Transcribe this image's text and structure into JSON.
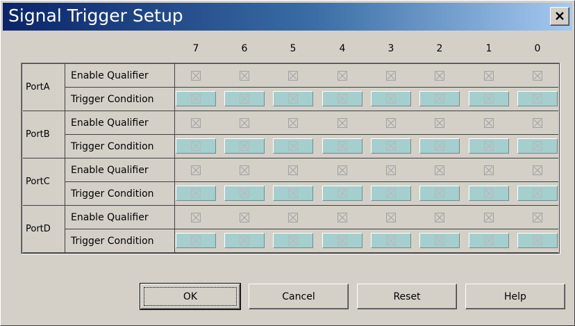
{
  "window": {
    "title": "Signal Trigger Setup"
  },
  "columns": [
    "7",
    "6",
    "5",
    "4",
    "3",
    "2",
    "1",
    "0"
  ],
  "ports": [
    {
      "name": "PortA",
      "enable_label": "Enable Qualifier",
      "trigger_label": "Trigger Condition"
    },
    {
      "name": "PortB",
      "enable_label": "Enable Qualifier",
      "trigger_label": "Trigger Condition"
    },
    {
      "name": "PortC",
      "enable_label": "Enable Qualifier",
      "trigger_label": "Trigger Condition"
    },
    {
      "name": "PortD",
      "enable_label": "Enable Qualifier",
      "trigger_label": "Trigger Condition"
    }
  ],
  "buttons": {
    "ok": "OK",
    "cancel": "Cancel",
    "reset": "Reset",
    "help": "Help"
  },
  "cell_state": "indeterminate-x",
  "colors": {
    "trigger_cell": "#a5cece",
    "title_start": "#0a246a",
    "title_end": "#a6caf0"
  }
}
